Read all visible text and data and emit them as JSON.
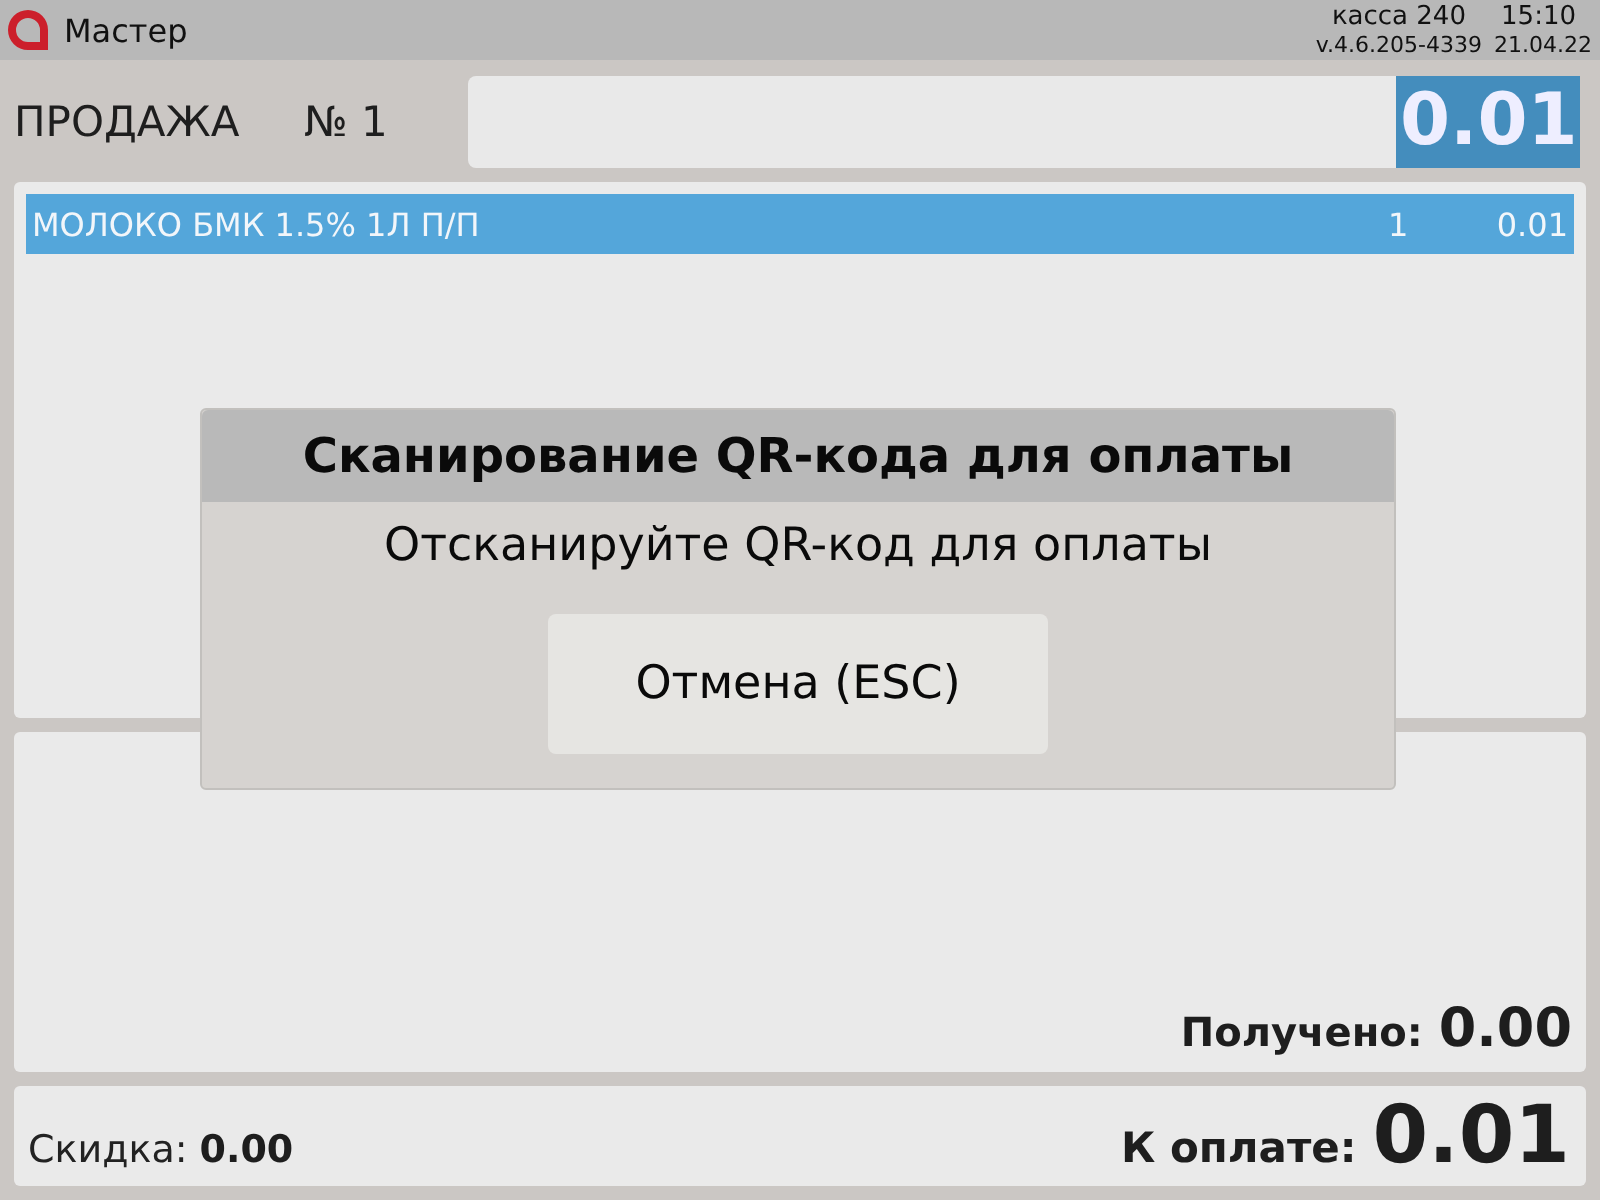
{
  "title_bar": {
    "app_name": "Мастер",
    "register": "касса 240",
    "time": "15:10",
    "version": "v.4.6.205-4339",
    "date": "21.04.22"
  },
  "sale": {
    "label": "ПРОДАЖА",
    "number": "№ 1",
    "amount": "0.01"
  },
  "items": [
    {
      "name": "МОЛОКО БМК 1.5% 1Л П/П",
      "quantity": "1",
      "price": "0.01",
      "selected": true
    }
  ],
  "payment": {
    "received_label": "Получено:",
    "received": "0.00"
  },
  "totals": {
    "discount_label": "Скидка:",
    "discount": "0.00",
    "due_label": "К оплате:",
    "due": "0.01"
  },
  "dialog": {
    "title": "Сканирование QR-кода для оплаты",
    "message": "Отсканируйте QR-код для оплаты",
    "buttons": [
      "Отмена (ESC)"
    ]
  }
}
